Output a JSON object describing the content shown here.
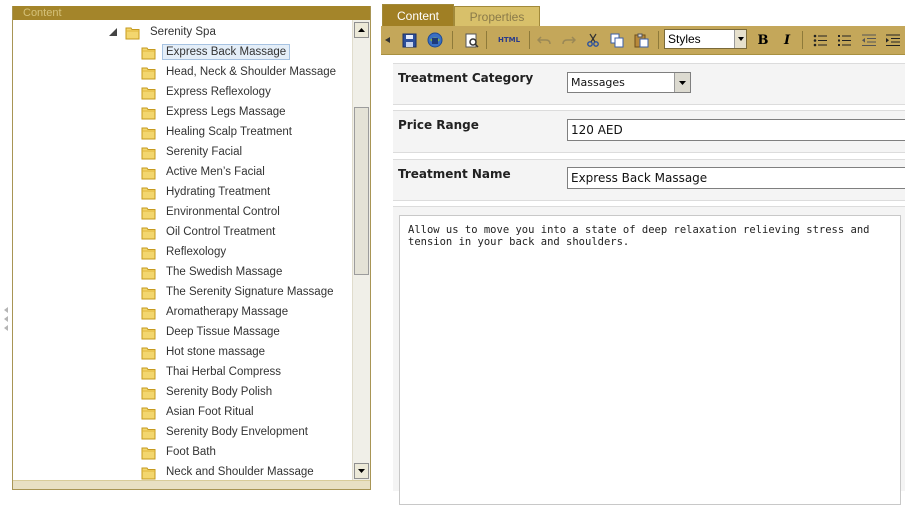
{
  "tree": {
    "header": "Content",
    "root": {
      "label": "Serenity Spa"
    },
    "items": [
      {
        "label": "Express Back Massage",
        "selected": true
      },
      {
        "label": "Head, Neck & Shoulder Massage"
      },
      {
        "label": "Express Reflexology"
      },
      {
        "label": "Express Legs Massage"
      },
      {
        "label": "Healing Scalp Treatment"
      },
      {
        "label": "Serenity Facial"
      },
      {
        "label": "Active Men’s Facial"
      },
      {
        "label": "Hydrating Treatment"
      },
      {
        "label": "Environmental Control"
      },
      {
        "label": "Oil Control Treatment"
      },
      {
        "label": "Reflexology"
      },
      {
        "label": "The Swedish Massage"
      },
      {
        "label": "The Serenity Signature Massage"
      },
      {
        "label": "Aromatherapy Massage"
      },
      {
        "label": "Deep Tissue Massage"
      },
      {
        "label": "Hot stone massage"
      },
      {
        "label": "Thai Herbal Compress"
      },
      {
        "label": "Serenity Body Polish"
      },
      {
        "label": "Asian Foot Ritual"
      },
      {
        "label": "Serenity Body Envelopment"
      },
      {
        "label": "Foot Bath"
      },
      {
        "label": "Neck and Shoulder Massage"
      }
    ]
  },
  "tabs": {
    "content": "Content",
    "properties": "Properties"
  },
  "toolbar": {
    "html_label": "HTML",
    "styles_value": "Styles",
    "bold_label": "B",
    "italic_label": "I"
  },
  "form": {
    "category": {
      "label": "Treatment Category",
      "value": "Massages"
    },
    "price": {
      "label": "Price Range",
      "value": "120 AED"
    },
    "name": {
      "label": "Treatment Name",
      "value": "Express Back Massage"
    },
    "description": "Allow us to move you into a state of deep relaxation relieving stress and tension in your back and shoulders."
  },
  "colors": {
    "header_gold": "#a4852a",
    "toolbar_gold": "#c4a75a",
    "selection_blue": "#e4eef8"
  }
}
